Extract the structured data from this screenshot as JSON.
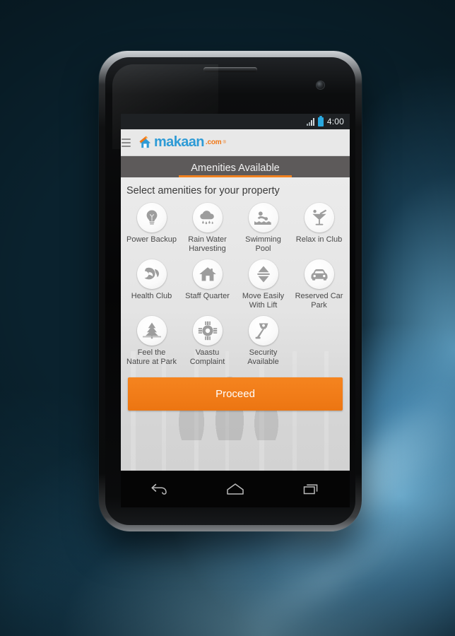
{
  "statusbar": {
    "time": "4:00",
    "signal_icon": "signal-bars-icon",
    "battery_icon": "battery-icon"
  },
  "brandbar": {
    "menu_icon": "hamburger-menu-icon",
    "logo_icon": "makaan-house-logo-icon",
    "logo_text": "makaan",
    "logo_suffix": ".com",
    "logo_registered": "®"
  },
  "tabbar": {
    "title": "Amenities Available",
    "accent_color": "#f0811f"
  },
  "content": {
    "select_title": "Select amenities for your property",
    "amenities": [
      {
        "label": "Power Backup",
        "icon": "lightbulb-icon"
      },
      {
        "label": "Rain Water Harvesting",
        "icon": "rain-cloud-icon"
      },
      {
        "label": "Swimming Pool",
        "icon": "swimmer-icon"
      },
      {
        "label": "Relax in Club",
        "icon": "cocktail-glass-icon"
      },
      {
        "label": "Health Club",
        "icon": "flexed-bicep-icon"
      },
      {
        "label": "Staff Quarter",
        "icon": "house-icon"
      },
      {
        "label": "Move Easily With Lift",
        "icon": "elevator-arrows-icon"
      },
      {
        "label": "Reserved Car Park",
        "icon": "car-icon"
      },
      {
        "label": "Feel the Nature at Park",
        "icon": "pine-tree-icon"
      },
      {
        "label": "Vaastu Complaint",
        "icon": "compass-directions-icon"
      },
      {
        "label": "Security Available",
        "icon": "cctv-camera-icon"
      }
    ]
  },
  "footer": {
    "proceed_label": "Proceed",
    "proceed_color": "#f1801c"
  },
  "navbar": {
    "back_icon": "android-back-icon",
    "home_icon": "android-home-icon",
    "recents_icon": "android-recents-icon"
  }
}
